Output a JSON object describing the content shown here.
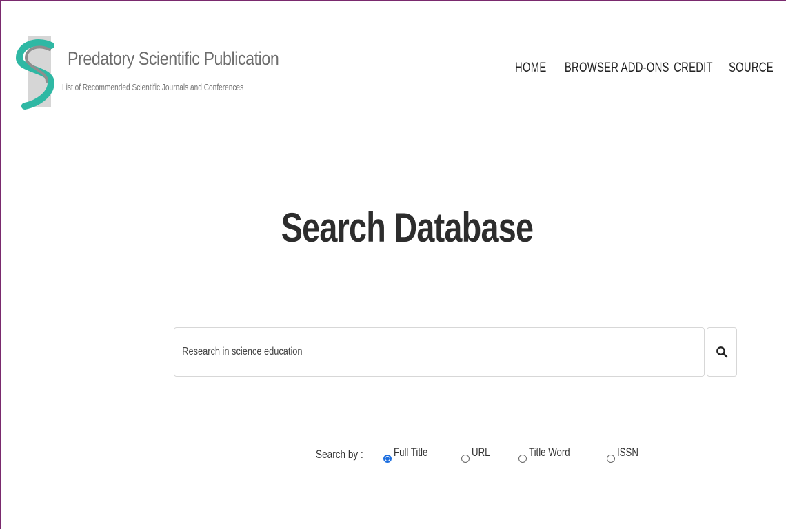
{
  "brand": {
    "title": "Predatory Scientific Publication",
    "subtitle": "List of Recommended Scientific Journals and Conferences",
    "logo_icon": "predatory-logo-icon",
    "accent_color": "#2fb8a4"
  },
  "nav": {
    "items": [
      {
        "label": "HOME"
      },
      {
        "label": "BROWSER ADD-ONS"
      },
      {
        "label": "CREDIT"
      },
      {
        "label": "SOURCE"
      }
    ]
  },
  "main": {
    "title": "Search Database",
    "search": {
      "value": "Research in science education",
      "button_icon": "search-icon"
    },
    "search_by": {
      "label": "Search by :",
      "options": [
        {
          "label": "Full Title",
          "checked": true
        },
        {
          "label": "URL",
          "checked": false
        },
        {
          "label": "Title Word",
          "checked": false
        },
        {
          "label": "ISSN",
          "checked": false
        }
      ],
      "checked_color": "#1d6fe0"
    }
  }
}
